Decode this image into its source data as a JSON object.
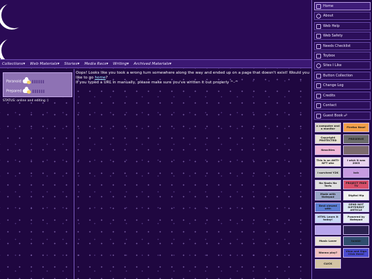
{
  "header": {},
  "nav": {
    "items": [
      "Collections▾",
      "Web Materials▾",
      "Stories▾",
      "Media Recs▾",
      "Writing▾",
      "Archived Materials▾"
    ]
  },
  "profile": {
    "row1_label": "Paranoid",
    "row1_value": "▌▌▌▌▌▌",
    "row2_label": "Prepared",
    "row2_value": "▌▌▌▌▌▌",
    "status": "STATUS: online and editing :)"
  },
  "main": {
    "message_part1": "Oops! Looks like you took a wrong turn somewhere along the way and ended up on a page that doesn't exist! Would you like to go ",
    "home_link": "home",
    "message_part2": "?",
    "message_line2": "If you typed a URL in manually, please make sure you've written it out properly ^-^"
  },
  "sidebar": {
    "items": [
      {
        "label": "Home",
        "icon": "home-icon"
      },
      {
        "label": "About",
        "icon": "info-icon"
      },
      {
        "label": "Web Help",
        "icon": "book-icon"
      },
      {
        "label": "Web Safety",
        "icon": "warning-icon"
      },
      {
        "label": "Needs Checklist",
        "icon": "checklist-icon"
      },
      {
        "label": "Toybox",
        "icon": "toybox-icon"
      },
      {
        "label": "Sites I Like",
        "icon": "heart-icon"
      },
      {
        "label": "Button Collection",
        "icon": "button-icon"
      },
      {
        "label": "Change Log",
        "icon": "log-icon"
      },
      {
        "label": "Credits",
        "icon": "credits-icon"
      },
      {
        "label": "Contact",
        "icon": "mail-icon"
      },
      {
        "label": "Guest Book ☍",
        "icon": "guestbook-icon"
      }
    ]
  },
  "buttons": [
    {
      "text": "a computer and a monitor",
      "bg": "#d9d4c8"
    },
    {
      "text": "Firefox Now!",
      "bg": "#f2a04a"
    },
    {
      "text": "Copyright PROTECTED",
      "bg": "#e6e1d2"
    },
    {
      "text": "PRESERVE",
      "bg": "#6a6a6a"
    },
    {
      "text": "Neocities",
      "bg": "#f0b6d6"
    },
    {
      "text": "",
      "bg": "#7c6a6e"
    },
    {
      "text": "This is an ANTI-NFT site",
      "bg": "#efe9e3"
    },
    {
      "text": "I wish it was 2003",
      "bg": "#e8d3ef"
    },
    {
      "text": "i survived Y2K",
      "bg": "#cfcfcf"
    },
    {
      "text": "bcb",
      "bg": "#c79be0"
    },
    {
      "text": "No Nazis No Terfs",
      "bg": "#e0e0e0"
    },
    {
      "text": "PROJECT FREE TV",
      "bg": "#d74f6a"
    },
    {
      "text": "Made with Notepad",
      "bg": "#9aa6c8"
    },
    {
      "text": "Digital Hip",
      "bg": "#f1f1f1"
    },
    {
      "text": "Best viewed with",
      "bg": "#5b7dd2"
    },
    {
      "text": "SEND NOT DIFFERENT ARTICLE",
      "bg": "#dbe6f2"
    },
    {
      "text": "HTML Learn it today!",
      "bg": "#c9d9f5"
    },
    {
      "text": "Powered by Notepad",
      "bg": "#e6eaf2"
    },
    {
      "text": "",
      "bg": "#b7a4ec"
    },
    {
      "text": "",
      "bg": "#2b2250"
    },
    {
      "text": "Music Lover",
      "bg": "#e8e2d6"
    },
    {
      "text": "tumblr",
      "bg": "#2f4d6e"
    },
    {
      "text": "Wanna play?",
      "bg": "#f1c2c2"
    },
    {
      "text": "View and Sign Click Here!",
      "bg": "#4a4ad0"
    },
    {
      "text": "CLICK",
      "bg": "#d4c4a4"
    }
  ]
}
